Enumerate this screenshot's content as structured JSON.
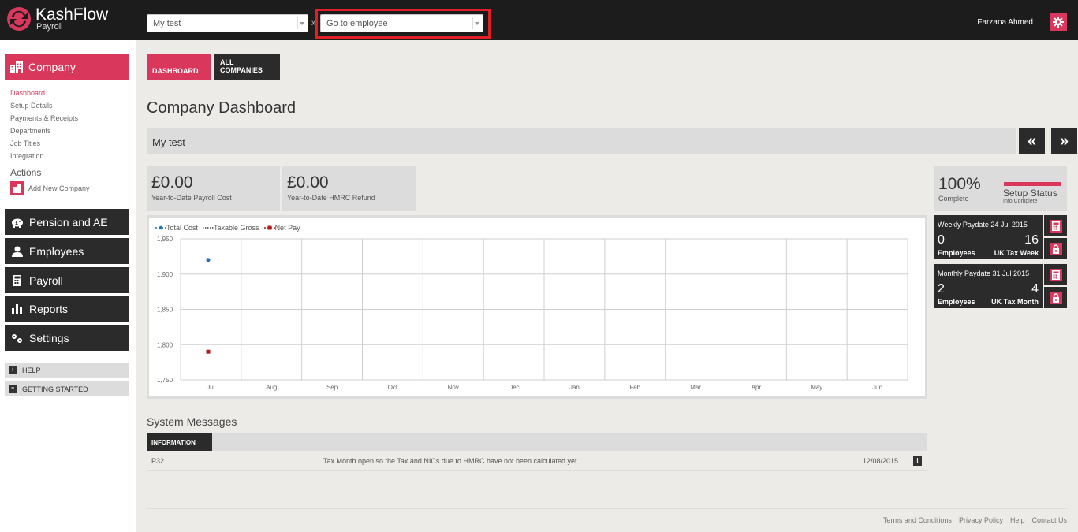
{
  "header": {
    "brand": "KashFlow",
    "brand_sub": "Payroll",
    "company_select": "My test",
    "clear_mark": "x",
    "employee_select": "Go to employee",
    "user_name": "Farzana Ahmed"
  },
  "sidebar": {
    "company_label": "Company",
    "subnav": [
      "Dashboard",
      "Setup Details",
      "Payments & Receipts",
      "Departments",
      "Job Titles",
      "Integration"
    ],
    "actions_title": "Actions",
    "add_company": "Add New Company",
    "main_nav": [
      "Pension and AE",
      "Employees",
      "Payroll",
      "Reports",
      "Settings"
    ],
    "help": "HELP",
    "getting_started": "GETTING STARTED"
  },
  "tabs": {
    "dashboard": "DASHBOARD",
    "all_companies_1": "ALL",
    "all_companies_2": "COMPANIES"
  },
  "page_title": "Company Dashboard",
  "company_bar": {
    "name": "My test",
    "prev": "«",
    "next": "»"
  },
  "stats": [
    {
      "amount": "£0.00",
      "label": "Year-to-Date Payroll Cost"
    },
    {
      "amount": "£0.00",
      "label": "Year-to-Date HMRC Refund"
    }
  ],
  "chart_data": {
    "type": "line",
    "categories": [
      "Jul",
      "Aug",
      "Sep",
      "Oct",
      "Nov",
      "Dec",
      "Jan",
      "Feb",
      "Mar",
      "Apr",
      "May",
      "Jun"
    ],
    "y_ticks": [
      "1,950",
      "1,900",
      "1,850",
      "1,800",
      "1,750"
    ],
    "ylim": [
      1750,
      1950
    ],
    "series": [
      {
        "name": "Total Cost",
        "color": "#1f6fbf",
        "values": [
          1920,
          null,
          null,
          null,
          null,
          null,
          null,
          null,
          null,
          null,
          null,
          null
        ]
      },
      {
        "name": "Taxable Gross",
        "color": "#444444",
        "values": [
          null,
          null,
          null,
          null,
          null,
          null,
          null,
          null,
          null,
          null,
          null,
          null
        ]
      },
      {
        "name": "Net Pay",
        "color": "#b31b1b",
        "values": [
          1790,
          null,
          null,
          null,
          null,
          null,
          null,
          null,
          null,
          null,
          null,
          null
        ]
      }
    ],
    "grid": true,
    "legend": "top-left"
  },
  "system_messages": {
    "title": "System Messages",
    "tab": "INFORMATION",
    "rows": [
      {
        "code": "P32",
        "message": "Tax Month open so the Tax and NICs due to HMRC have not been calculated yet",
        "date": "12/08/2015",
        "icon": "i"
      }
    ]
  },
  "setup": {
    "percent": "100%",
    "complete": "Complete",
    "status": "Setup Status",
    "info": "Info Complete",
    "progress": 1.0
  },
  "paydates": [
    {
      "title": "Weekly Paydate 24 Jul 2015",
      "employees": "0",
      "employees_label": "Employees",
      "tax": "16",
      "tax_label": "UK Tax Week"
    },
    {
      "title": "Monthly Paydate 31 Jul 2015",
      "employees": "2",
      "employees_label": "Employees",
      "tax": "4",
      "tax_label": "UK Tax Month"
    }
  ],
  "footer": [
    "Terms and Conditions",
    "Privacy Policy",
    "Help",
    "Contact Us"
  ],
  "colors": {
    "accent": "#d9375c",
    "dark": "#2b2b2b",
    "topbar": "#1c1c1c"
  }
}
